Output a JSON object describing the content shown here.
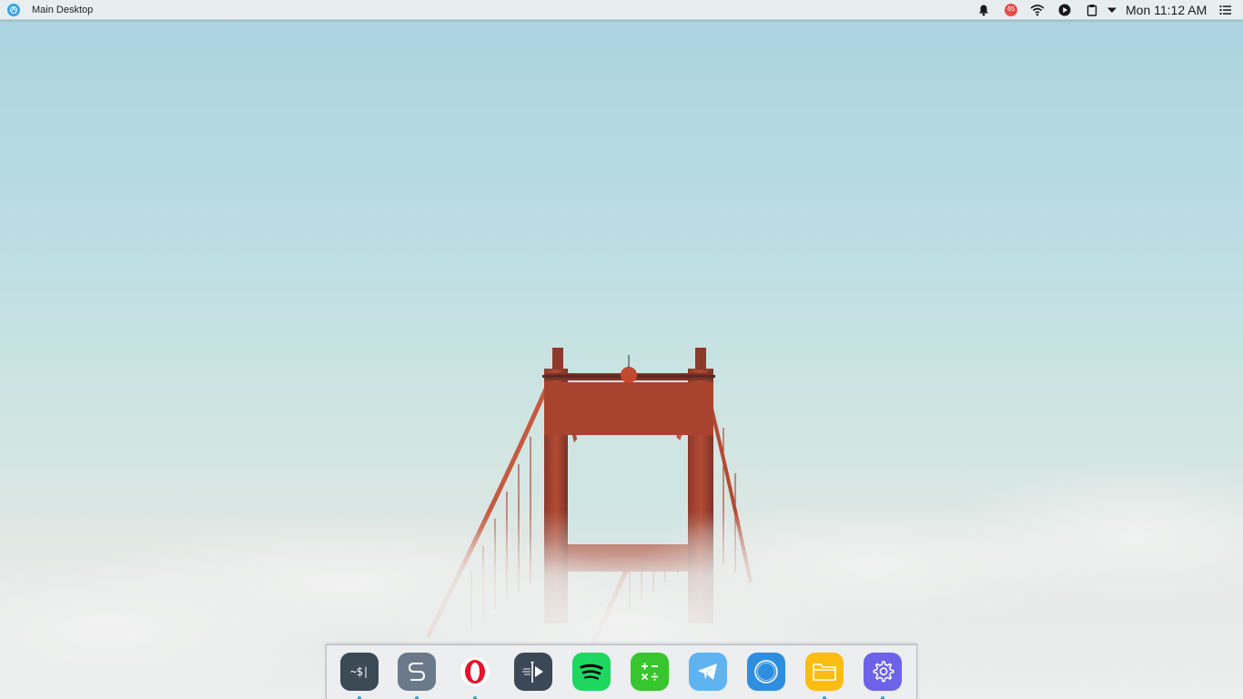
{
  "top_panel": {
    "workspace_label": "Main Desktop",
    "notification_count": "65",
    "clock": "Mon 11:12 AM"
  },
  "icons": {
    "launcher": "launcher-icon",
    "notifications": "bell-icon",
    "wifi": "wifi-icon",
    "media": "play-icon",
    "clipboard": "clipboard-icon",
    "menu_arrow": "caret-down-icon",
    "tasks": "list-icon"
  },
  "dock": {
    "items": [
      {
        "name": "terminal",
        "label": "~$|",
        "color": "#3c4a57",
        "running": true
      },
      {
        "name": "simplenote",
        "label": "S",
        "color": "#6b7a8a",
        "running": true
      },
      {
        "name": "opera",
        "color": "#ffffff",
        "running": true
      },
      {
        "name": "video-editor",
        "color": "#3b4856",
        "running": false
      },
      {
        "name": "spotify",
        "color": "#1ed760",
        "running": false
      },
      {
        "name": "calculator",
        "color": "#37c62d",
        "running": false
      },
      {
        "name": "telegram",
        "color": "#5fb3ef",
        "running": false
      },
      {
        "name": "app-blue",
        "color": "#2e8ee0",
        "running": false
      },
      {
        "name": "files",
        "color": "#fbbc14",
        "running": true
      },
      {
        "name": "settings",
        "color": "#6c63e9",
        "running": true
      }
    ]
  },
  "colors": {
    "panel_bg": "#e8eef0",
    "dock_indicator": "#2aa3e0",
    "bridge": "#b94b36"
  }
}
